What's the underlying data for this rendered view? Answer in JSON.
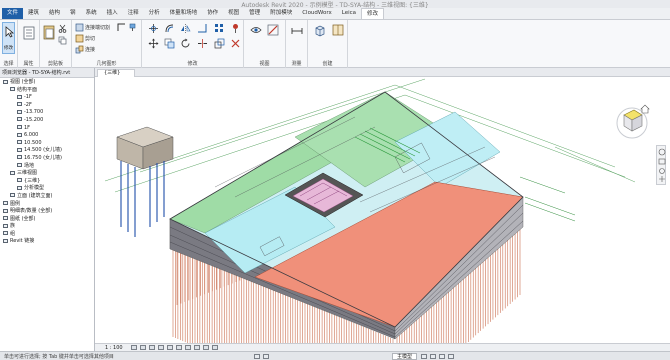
{
  "window": {
    "title": "Autodesk Revit 2020 - 示例模型 - TD-SYA-结构 - 三维视图: {三维}"
  },
  "ribbon": {
    "tabs": [
      {
        "label": "文件"
      },
      {
        "label": "建筑"
      },
      {
        "label": "结构"
      },
      {
        "label": "钢"
      },
      {
        "label": "系统"
      },
      {
        "label": "插入"
      },
      {
        "label": "注释"
      },
      {
        "label": "分析"
      },
      {
        "label": "体量和场地"
      },
      {
        "label": "协作"
      },
      {
        "label": "视图"
      },
      {
        "label": "管理"
      },
      {
        "label": "附加模块"
      },
      {
        "label": "CloudWorx"
      },
      {
        "label": "Leica"
      },
      {
        "label": "修改"
      }
    ],
    "modify_label": "修改",
    "groups": {
      "select": "选择",
      "properties": "属性",
      "clipboard": "剪贴板",
      "geometry": "几何图形",
      "modify": "修改",
      "view": "视图",
      "measure": "测量",
      "create": "创建"
    },
    "geometry_items": [
      "连接端切割",
      "剪切",
      "连接"
    ]
  },
  "project_browser": {
    "header": "项目浏览器 - TD-SYA-结构.rvt",
    "tree": [
      {
        "label": "视图 (全部)",
        "indent": 0
      },
      {
        "label": "结构平面",
        "indent": 1
      },
      {
        "label": "-1F",
        "indent": 2
      },
      {
        "label": "-2F",
        "indent": 2
      },
      {
        "label": "-13.700",
        "indent": 2
      },
      {
        "label": "-15.200",
        "indent": 2
      },
      {
        "label": "1F",
        "indent": 2
      },
      {
        "label": "6.000",
        "indent": 2
      },
      {
        "label": "10.500",
        "indent": 2
      },
      {
        "label": "14.500 (女儿墙)",
        "indent": 2
      },
      {
        "label": "16.750 (女儿墙)",
        "indent": 2
      },
      {
        "label": "场地",
        "indent": 2
      },
      {
        "label": "三维视图",
        "indent": 1
      },
      {
        "label": "{三维}",
        "indent": 2
      },
      {
        "label": "分析模型",
        "indent": 2
      },
      {
        "label": "立面 (建筑立面)",
        "indent": 1
      },
      {
        "label": "图例",
        "indent": 0
      },
      {
        "label": "明细表/数量 (全部)",
        "indent": 0
      },
      {
        "label": "图纸 (全部)",
        "indent": 0
      },
      {
        "label": "族",
        "indent": 0
      },
      {
        "label": "组",
        "indent": 0
      },
      {
        "label": "Revit 链接",
        "indent": 0
      }
    ]
  },
  "view": {
    "tab_label": "{三维}",
    "scale": "1 : 100"
  },
  "status_bar": {
    "message": "单击可进行选择; 按 Tab 键并单击可选择其他项目",
    "model": "主模型"
  },
  "colors": {
    "roof_green": "#9fdca6",
    "roof_cyan": "#b6ecf3",
    "roof_salmon": "#f0907a",
    "wall_gray": "#9a9aa0",
    "piles": "#d2846a"
  }
}
